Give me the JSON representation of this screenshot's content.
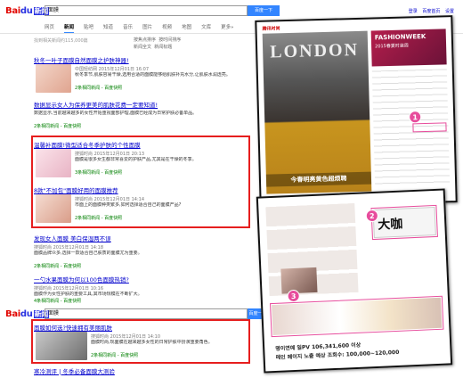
{
  "header": {
    "logo_bai": "Bai",
    "logo_du": "du",
    "logo_news": "新闻",
    "query": "面膜",
    "search_btn": "百度一下",
    "top_links": [
      "登录",
      "百度首页",
      "设置"
    ]
  },
  "tabs": [
    "网页",
    "新闻",
    "贴吧",
    "知道",
    "音乐",
    "图片",
    "视频",
    "地图",
    "文库",
    "更多»"
  ],
  "stats": "找到相关新闻约115,000篇",
  "sort": {
    "opt1": "按焦点排序",
    "opt2": "按时间排序",
    "opt3": "新闻全文",
    "opt4": "新闻标题"
  },
  "results": [
    {
      "title": "秋冬一叶子面膜自然面膜之护肤神器!",
      "src": "中国轻纺网 2015年12月01日 16:07",
      "snip": "秋冬季节,肌肤容易干燥,选用合适的面膜能够给肌肤补充水分,让肌肤水润透亮。",
      "more": "2条相同新闻 - 百度快照"
    },
    {
      "title": "数据显示女人为保养更美的肌肤花费一定要知道!",
      "src": "",
      "snip": "数据显示,当前越来越多的女性开始重视面部护理,面膜已经成为日常护肤必备单品。",
      "more": "2条相同新闻 - 百度快照"
    },
    {
      "title": "温馨补面膜!微型适合冬季护肤的个性面膜",
      "src": "搜狐时尚 2015年12月01日 20:13",
      "snip": "面膜是很多女生都非常喜爱的护肤产品,尤其是在干燥的冬季。",
      "more": "3条相同新闻 - 百度快照"
    },
    {
      "title": "8款\"不加包\"面膜好用的面膜推荐",
      "src": "搜狐时尚 2015年12月01日 14:14",
      "snip": "市面上的面膜种类繁多,如何选择适合自己的面膜产品?",
      "more": "2条相同新闻 - 百度快照"
    },
    {
      "title": "发现女人面膜 美白保湿两不误",
      "src": "搜狐时尚 2015年12月01日 14:18",
      "snip": "面膜品牌众多,选择一款适合自己肤质的面膜尤为重要。",
      "more": "2条相同新闻 - 百度快照"
    },
    {
      "title": "一勺水果面膜为何以100色面膜热销?",
      "src": "搜狐时尚 2015年12月01日 10:16",
      "snip": "面膜作为女性护肤的重要工具,其市场规模在不断扩大。",
      "more": "4条相同新闻 - 百度快照"
    }
  ],
  "bottom": {
    "logo_bai": "Bai",
    "logo_du": "du",
    "logo_news": "新闻",
    "query": "面膜",
    "search_btn": "百度一",
    "r_title": "面膜如何选?快速拥有美丽肌肤",
    "r_src": "搜狐时尚 2015年12月01日 14:10",
    "r_snip": "面膜时尚,现面膜在越来越多女性的日常护肤中扮演重要角色。",
    "r_more": "2条相同新闻 - 百度快照",
    "last": "寒冷测评 | 冬季必备面膜大测验"
  },
  "panel1": {
    "brand": "腾讯时尚",
    "magazine": "LONDON",
    "fashionweek": "FASHIONWEEK",
    "fw_sub": "2015春夏时装周",
    "caption": "今春明亮黄色超烦聘",
    "badge": "1"
  },
  "panel2": {
    "headline": "大咖",
    "korean1": "명이연예 일PV 106,341,600 이상",
    "korean2": "메인 페이지 노출 예상 조회수: 100,000~120,000",
    "badge2": "2",
    "badge3": "3"
  }
}
